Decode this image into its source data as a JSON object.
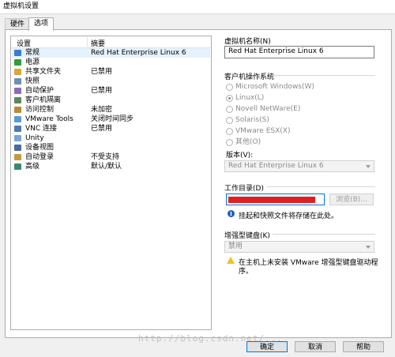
{
  "window": {
    "title": "虚拟机设置"
  },
  "tabs": [
    {
      "label": "硬件"
    },
    {
      "label": "选项"
    }
  ],
  "list": {
    "header": {
      "col1": "设置",
      "col2": "摘要"
    },
    "items": [
      {
        "name": "常规",
        "summary": "Red Hat Enterprise Linux 6",
        "icon": "general-icon",
        "color": "#3a7bd5"
      },
      {
        "name": "电源",
        "summary": "",
        "icon": "power-icon",
        "color": "#2e9e3e"
      },
      {
        "name": "共享文件夹",
        "summary": "已禁用",
        "icon": "shared-folder-icon",
        "color": "#d7a73a"
      },
      {
        "name": "快照",
        "summary": "",
        "icon": "snapshot-icon",
        "color": "#6d8fb8"
      },
      {
        "name": "自动保护",
        "summary": "已禁用",
        "icon": "autoprotect-icon",
        "color": "#8a6bb8"
      },
      {
        "name": "客户机隔离",
        "summary": "",
        "icon": "isolation-icon",
        "color": "#5a8a5a"
      },
      {
        "name": "访问控制",
        "summary": "未加密",
        "icon": "access-control-icon",
        "color": "#b88a3a"
      },
      {
        "name": "VMware Tools",
        "summary": "关闭时间同步",
        "icon": "vmware-tools-icon",
        "color": "#5a9ad5"
      },
      {
        "name": "VNC 连接",
        "summary": "已禁用",
        "icon": "vnc-icon",
        "color": "#4a7ab5"
      },
      {
        "name": "Unity",
        "summary": "",
        "icon": "unity-icon",
        "color": "#7aa5d5"
      },
      {
        "name": "设备视图",
        "summary": "",
        "icon": "device-view-icon",
        "color": "#4a6a9a"
      },
      {
        "name": "自动登录",
        "summary": "不受支持",
        "icon": "autologin-icon",
        "color": "#c59a3a"
      },
      {
        "name": "高级",
        "summary": "默认/默认",
        "icon": "advanced-icon",
        "color": "#3a8a6a"
      }
    ]
  },
  "vm_name": {
    "label": "虚拟机名称(N)",
    "value": "Red Hat Enterprise Linux 6"
  },
  "guest_os": {
    "label": "客户机操作系统",
    "options": [
      {
        "label": "Microsoft Windows(W)",
        "selected": false
      },
      {
        "label": "Linux(L)",
        "selected": true
      },
      {
        "label": "Novell NetWare(E)",
        "selected": false
      },
      {
        "label": "Solaris(S)",
        "selected": false
      },
      {
        "label": "VMware ESX(X)",
        "selected": false
      },
      {
        "label": "其他(O)",
        "selected": false
      }
    ],
    "version_label": "版本(V):",
    "version_value": "Red Hat Enterprise Linux 6"
  },
  "working_dir": {
    "label": "工作目录(D)",
    "browse_label": "浏览(B)...",
    "note": "挂起和快照文件将存储在此处。"
  },
  "enhanced_keyboard": {
    "label": "增强型键盘(K)",
    "value": "禁用",
    "note_line1": "在主机上未安装 VMware 增强型键盘驱动程",
    "note_line2": "序。"
  },
  "buttons": {
    "ok": "确定",
    "cancel": "取消",
    "help": "帮助"
  },
  "colors": {
    "accent": "#0078d7",
    "redacted": "#e02020",
    "selected_row": "#e5f1fb"
  },
  "watermark": "http://blog.csdn.net/..."
}
